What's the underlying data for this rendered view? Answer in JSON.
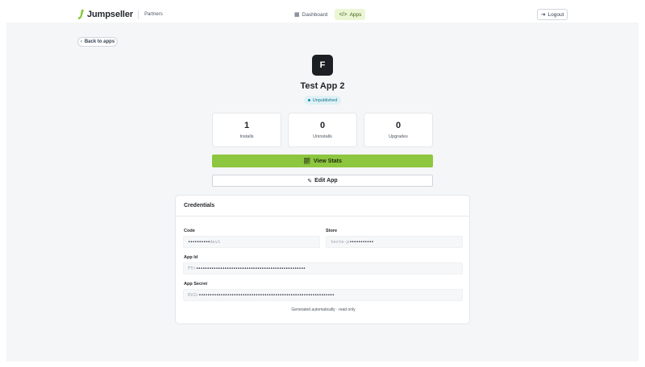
{
  "header": {
    "brand": "Jumpseller",
    "section": "Partners",
    "nav": [
      {
        "label": "Dashboard",
        "icon": "dashboard-icon"
      },
      {
        "label": "Apps",
        "icon": "code-icon"
      }
    ],
    "logout_label": "Logout"
  },
  "back_label": "Back to apps",
  "app": {
    "initial": "F",
    "name": "Test App 2",
    "status": "Unpublished"
  },
  "stats": [
    {
      "value": "1",
      "label": "Installs"
    },
    {
      "value": "0",
      "label": "Uninstalls"
    },
    {
      "value": "0",
      "label": "Upgrades"
    }
  ],
  "actions": {
    "view_stats": "View Stats",
    "edit_app": "Edit App"
  },
  "credentials": {
    "title": "Credentials",
    "code_label": "Code",
    "code_visible": "dev1",
    "code_masked": "••••••••••",
    "store_label": "Store",
    "store_visible": "teste-p",
    "store_masked": "•••••••••••",
    "app_id_label": "App Id",
    "app_id_visible": "FTr",
    "app_id_masked": "••••••••••••••••••••••••••••••••••••••••••••••••••",
    "app_secret_label": "App Secret",
    "app_secret_visible": "DVZc",
    "app_secret_masked": "••••••••••••••••••••••••••••••••••••••••••••••••••••••••••••••",
    "footnote": "Generated automatically · read only"
  },
  "colors": {
    "accent_green": "#8dc63f",
    "badge_bg": "#dff1f5",
    "badge_text": "#0e7490",
    "dark_icon": "#1c1f23"
  }
}
